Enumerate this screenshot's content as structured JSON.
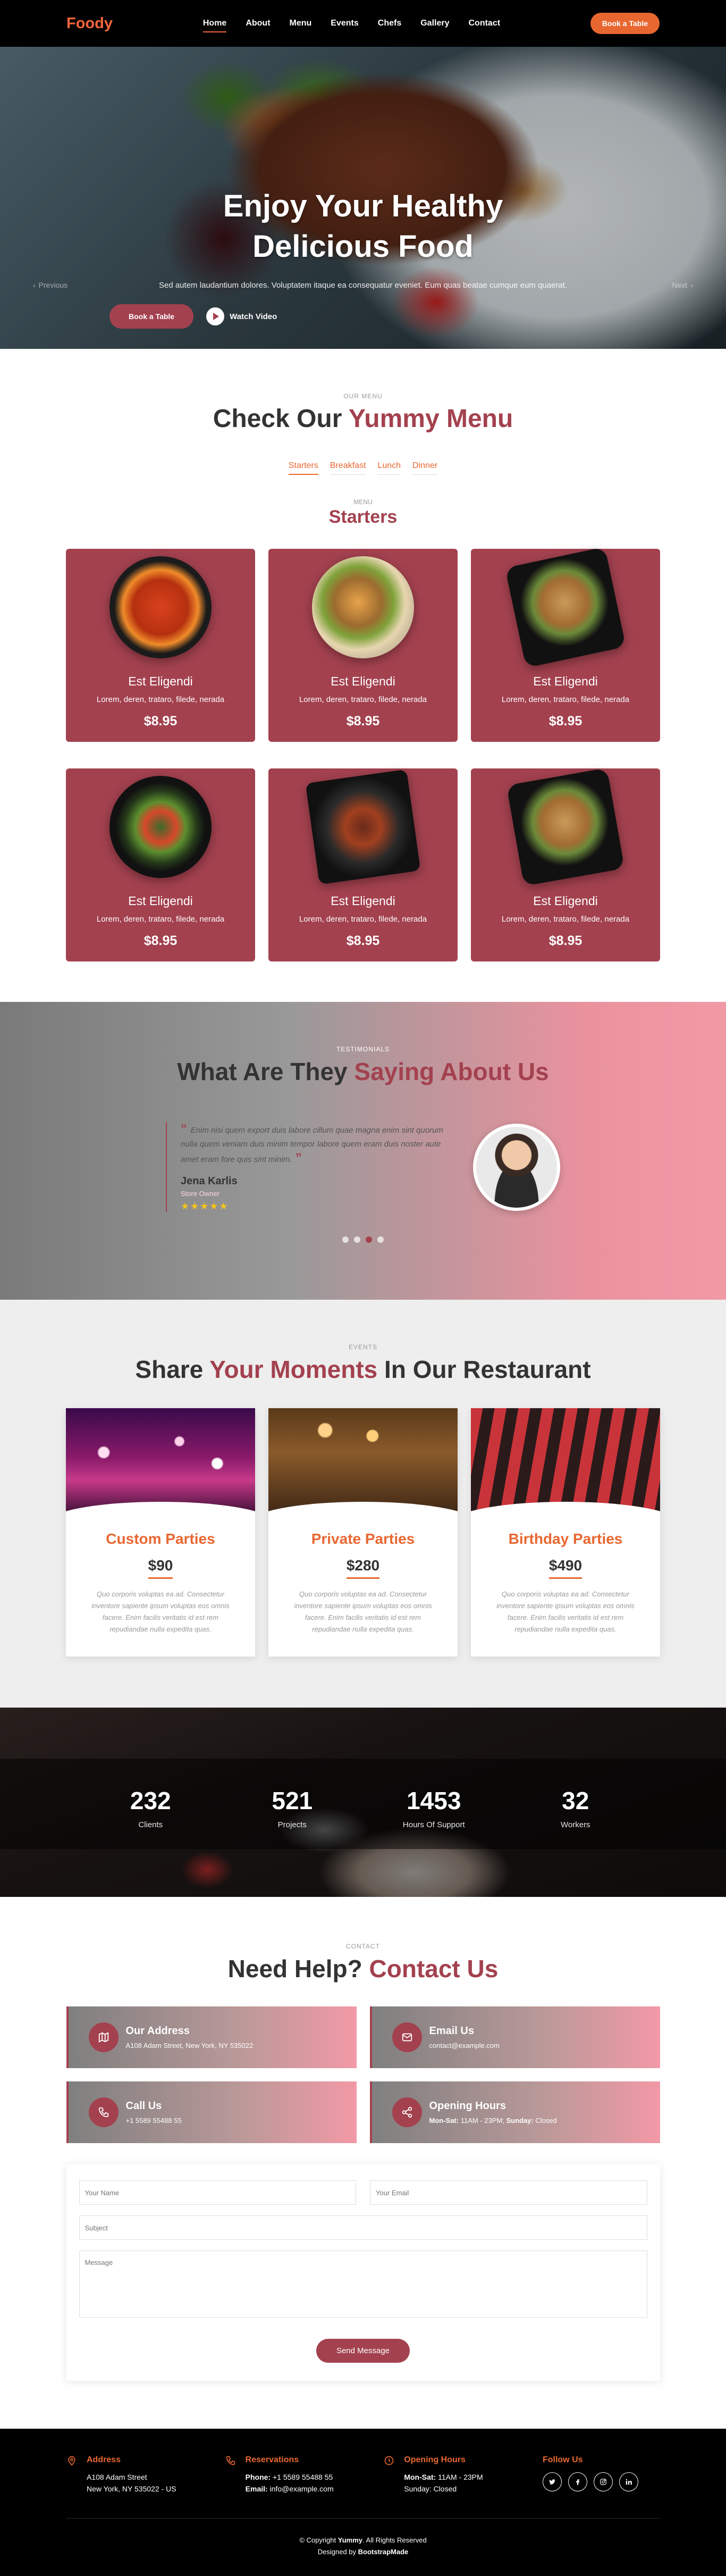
{
  "header": {
    "logo": "Foody",
    "nav": [
      "Home",
      "About",
      "Menu",
      "Events",
      "Chefs",
      "Gallery",
      "Contact"
    ],
    "book_label": "Book a Table"
  },
  "hero": {
    "title_line1": "Enjoy Your Healthy",
    "title_line2": "Delicious Food",
    "text": "Sed autem laudantium dolores. Voluptatem itaque ea consequatur eveniet. Eum quas beatae cumque eum quaerat.",
    "book_label": "Book a Table",
    "video_label": "Watch Video",
    "prev_label": "Previous",
    "next_label": "Next"
  },
  "menu": {
    "eyebrow": "Our Menu",
    "title_pre": "Check Our ",
    "title_accent": "Yummy Menu",
    "tabs": [
      "Starters",
      "Breakfast",
      "Lunch",
      "Dinner"
    ],
    "category_small": "Menu",
    "category": "Starters",
    "items": [
      {
        "name": "Est Eligendi",
        "desc": "Lorem, deren, trataro, filede, nerada",
        "price": "$8.95"
      },
      {
        "name": "Est Eligendi",
        "desc": "Lorem, deren, trataro, filede, nerada",
        "price": "$8.95"
      },
      {
        "name": "Est Eligendi",
        "desc": "Lorem, deren, trataro, filede, nerada",
        "price": "$8.95"
      },
      {
        "name": "Est Eligendi",
        "desc": "Lorem, deren, trataro, filede, nerada",
        "price": "$8.95"
      },
      {
        "name": "Est Eligendi",
        "desc": "Lorem, deren, trataro, filede, nerada",
        "price": "$8.95"
      },
      {
        "name": "Est Eligendi",
        "desc": "Lorem, deren, trataro, filede, nerada",
        "price": "$8.95"
      }
    ]
  },
  "testimonials": {
    "eyebrow": "Testimonials",
    "title_pre": "What Are They ",
    "title_accent": "Saying About Us",
    "quote": "Enim nisi quem export duis labore cillum quae magna enim sint quorum nulla quem veniam duis minim tempor labore quem eram duis noster aute amet eram fore quis sint minim.",
    "name": "Jena Karlis",
    "role": "Store Owner",
    "stars": "★★★★★"
  },
  "events": {
    "eyebrow": "Events",
    "title_pre": "Share ",
    "title_accent": "Your Moments",
    "title_post": " In Our Restaurant",
    "items": [
      {
        "title": "Custom Parties",
        "price": "$90",
        "desc": "Quo corporis voluptas ea ad. Consectetur inventore sapiente ipsum voluptas eos omnis facere. Enim facilis veritatis id est rem repudiandae nulla expedita quas."
      },
      {
        "title": "Private Parties",
        "price": "$280",
        "desc": "Quo corporis voluptas ea ad. Consectetur inventore sapiente ipsum voluptas eos omnis facere. Enim facilis veritatis id est rem repudiandae nulla expedita quas."
      },
      {
        "title": "Birthday Parties",
        "price": "$490",
        "desc": "Quo corporis voluptas ea ad. Consectetur inventore sapiente ipsum voluptas eos omnis facere. Enim facilis veritatis id est rem repudiandae nulla expedita quas."
      }
    ]
  },
  "stats": [
    {
      "value": "232",
      "label": "Clients"
    },
    {
      "value": "521",
      "label": "Projects"
    },
    {
      "value": "1453",
      "label": "Hours Of Support"
    },
    {
      "value": "32",
      "label": "Workers"
    }
  ],
  "contact": {
    "eyebrow": "Contact",
    "title_pre": "Need Help? ",
    "title_accent": "Contact Us",
    "address_title": "Our Address",
    "address_text": "A108 Adam Street, New York, NY 535022",
    "email_title": "Email Us",
    "email_text": "contact@example.com",
    "call_title": "Call Us",
    "call_text": "+1 5589 55488 55",
    "hours_title": "Opening Hours",
    "hours_days1": "Mon-Sat:",
    "hours_time1": " 11AM - 23PM;",
    "hours_days2": " Sunday:",
    "hours_time2": " Closed",
    "form": {
      "name_placeholder": "Your Name",
      "email_placeholder": "Your Email",
      "subject_placeholder": "Subject",
      "message_placeholder": "Message",
      "send_label": "Send Message"
    }
  },
  "footer": {
    "address_title": "Address",
    "address_line1": "A108 Adam Street",
    "address_line2": "New York, NY 535022 - US",
    "reservations_title": "Reservations",
    "phone_label": "Phone:",
    "phone_value": " +1 5589 55488 55",
    "email_label": "Email:",
    "email_value": " info@example.com",
    "hours_title": "Opening Hours",
    "hours_line1_label": "Mon-Sat:",
    "hours_line1_value": " 11AM - 23PM",
    "hours_line2": "Sunday: Closed",
    "follow_title": "Follow Us",
    "copyright_pre": "© Copyright ",
    "copyright_brand": "Yummy",
    "copyright_post": ". All Rights Reserved",
    "designed_pre": "Designed by ",
    "designed_brand": "BootstrapMade"
  },
  "colors": {
    "accent": "#a3414f",
    "orange": "#e86731"
  },
  "icons": [
    "play-icon",
    "map-icon",
    "envelope-icon",
    "phone-icon",
    "share-icon",
    "geo-icon",
    "phone-icon",
    "clock-icon",
    "twitter-icon",
    "facebook-icon",
    "instagram-icon",
    "linkedin-icon"
  ]
}
